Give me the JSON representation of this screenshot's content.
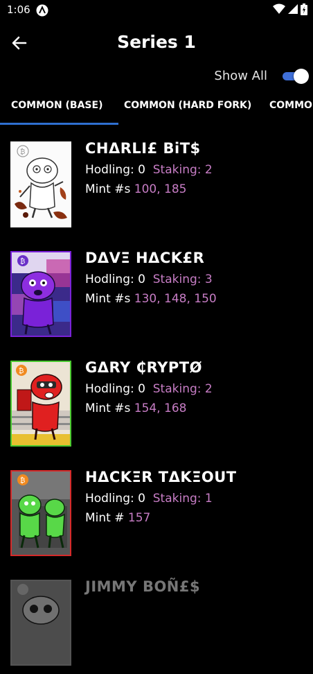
{
  "status_bar": {
    "time": "1:06"
  },
  "header": {
    "title": "Series 1"
  },
  "show_all": {
    "label": "Show All",
    "enabled": true
  },
  "tabs": [
    {
      "label": "COMMON (BASE)",
      "selected": true
    },
    {
      "label": "COMMON (HARD FORK)",
      "selected": false
    },
    {
      "label": "COMMO",
      "selected": false
    }
  ],
  "colors": {
    "accent": "#c77dc5",
    "tab_indicator": "#2f6fd0",
    "toggle": "#3f6fd8"
  },
  "items": [
    {
      "name": "CHΔRLI£ BiT$",
      "hodling_label": "Hodling: 0",
      "staking_label": "Staking: 2",
      "mint_label": "Mint #s",
      "mint_values": "100, 185",
      "frame_color": "#ffffff"
    },
    {
      "name": "DΔVΞ HΔCK£R",
      "hodling_label": "Hodling: 0",
      "staking_label": "Staking: 3",
      "mint_label": "Mint #s",
      "mint_values": "130, 148, 150",
      "frame_color": "#7a22d8"
    },
    {
      "name": "GΔRY ₵RYPTØ",
      "hodling_label": "Hodling: 0",
      "staking_label": "Staking: 2",
      "mint_label": "Mint #s",
      "mint_values": "154, 168",
      "frame_color": "#49c92f"
    },
    {
      "name": "HΔCKΞR TΔKΞOUT",
      "hodling_label": "Hodling: 0",
      "staking_label": "Staking: 1",
      "mint_label": "Mint #",
      "mint_values": "157",
      "frame_color": "#d62a2a"
    },
    {
      "name": "JIMMY BOÑ£$",
      "frame_color": "#9a9a9a"
    }
  ]
}
